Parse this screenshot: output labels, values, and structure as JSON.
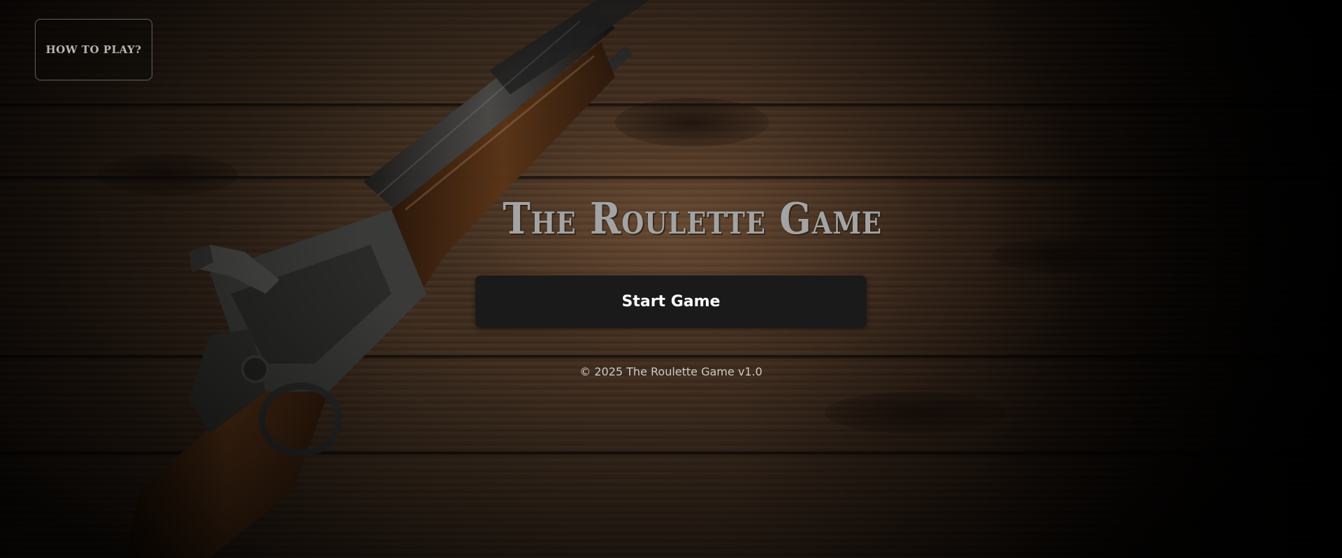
{
  "menu": {
    "how_to_play_label": "HOW TO PLAY?"
  },
  "main": {
    "title": "The Roulette Game",
    "start_button_label": "Start Game",
    "footer": "© 2025 The Roulette Game v1.0"
  },
  "colors": {
    "title": "#a3a3a3",
    "button_bg": "#1a1a1a",
    "button_text": "#ffffff",
    "footer_text": "#cfcac4"
  }
}
